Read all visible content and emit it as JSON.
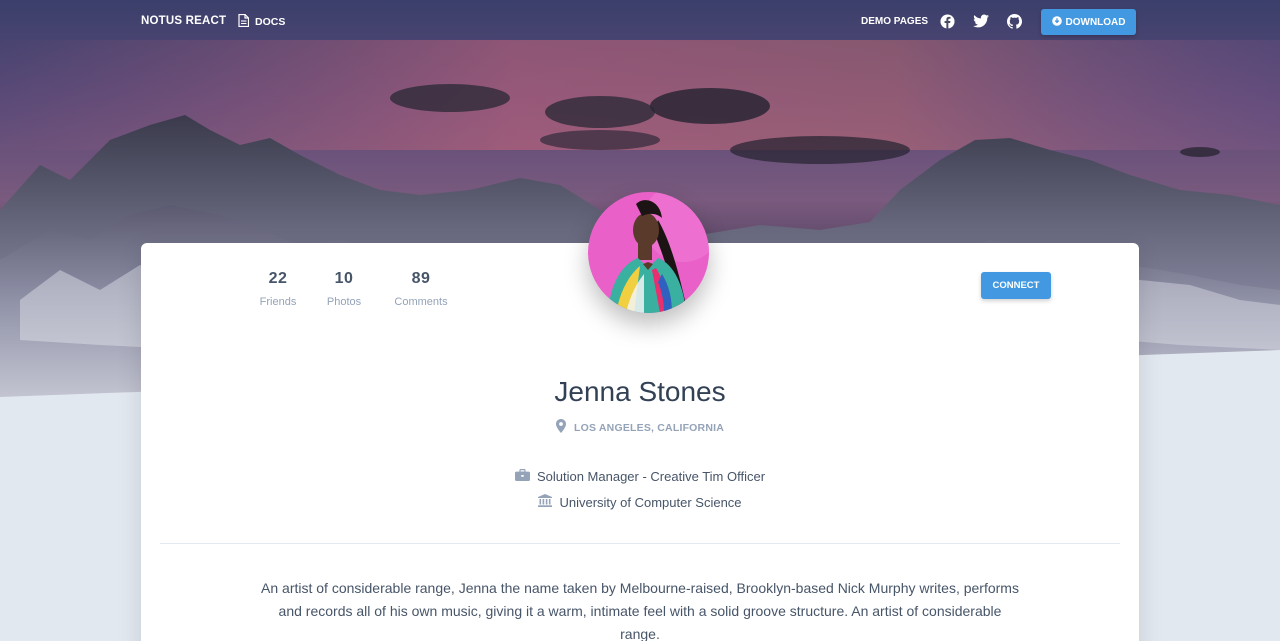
{
  "nav": {
    "brand": "NOTUS REACT",
    "docs_label": "DOCS",
    "demo_pages_label": "DEMO PAGES",
    "download_label": "DOWNLOAD",
    "social_icons": [
      "facebook-icon",
      "twitter-icon",
      "github-icon"
    ]
  },
  "profile": {
    "stats": [
      {
        "value": "22",
        "label": "Friends"
      },
      {
        "value": "10",
        "label": "Photos"
      },
      {
        "value": "89",
        "label": "Comments"
      }
    ],
    "connect_label": "CONNECT",
    "name": "Jenna Stones",
    "location": "LOS ANGELES, CALIFORNIA",
    "job": "Solution Manager - Creative Tim Officer",
    "education": "University of Computer Science",
    "bio": "An artist of considerable range, Jenna the name taken by Melbourne-raised, Brooklyn-based Nick Murphy writes, performs and records all of his own music, giving it a warm, intimate feel with a solid groove structure. An artist of considerable range."
  },
  "colors": {
    "accent": "#4299e1",
    "page_bg": "#e2e8f0",
    "heading": "#334155",
    "muted": "#94a3b8"
  }
}
